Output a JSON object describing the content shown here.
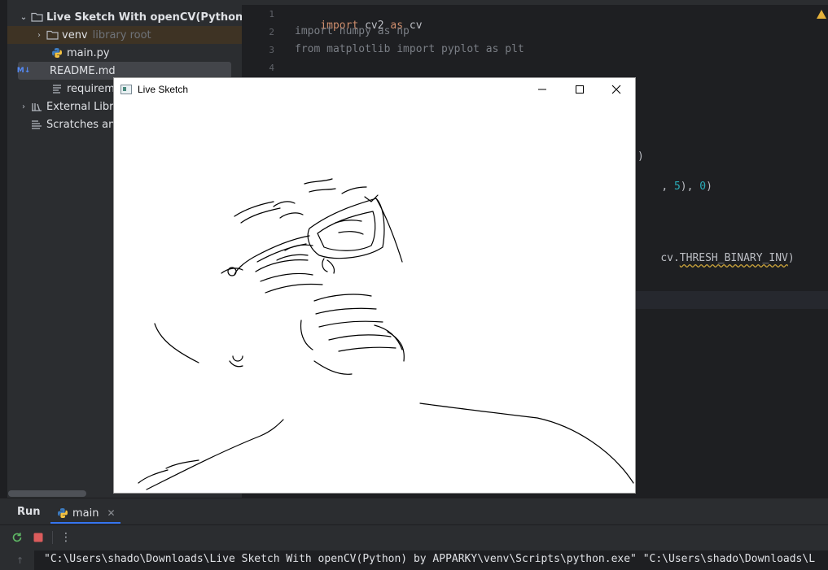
{
  "project": {
    "root": {
      "name": "Live Sketch With openCV(Python) by"
    },
    "venv": {
      "name": "venv",
      "hint": "library root"
    },
    "files": [
      "main.py",
      "README.md",
      "requireme"
    ],
    "external": "External Libr",
    "scratches": "Scratches an"
  },
  "editor": {
    "line_numbers": [
      "1",
      "2",
      "3",
      "4"
    ],
    "code": {
      "l1_kw1": "import",
      "l1_mod": " cv2 ",
      "l1_kw2": "as",
      "l1_alias": " cv",
      "l2": "import numpy as np",
      "l3": "from matplotlib import pyplot as plt",
      "frag1": ")",
      "frag2_pre": ", ",
      "frag2_n1": "5",
      "frag2_mid": "), ",
      "frag2_n2": "0",
      "frag2_post": ")",
      "frag3_pre": "cv.",
      "frag3_const": "THRESH_BINARY_INV",
      "frag3_post": ")"
    }
  },
  "run": {
    "title": "Run",
    "tab_label": "main",
    "console_line": "\"C:\\Users\\shado\\Downloads\\Live Sketch With openCV(Python) by APPARKY\\venv\\Scripts\\python.exe\" \"C:\\Users\\shado\\Downloads\\L"
  },
  "sketch_window": {
    "title": "Live Sketch"
  },
  "icons": {
    "folder": "folder-icon",
    "python": "python-file-icon",
    "markdown": "markdown-file-icon",
    "text": "text-file-icon",
    "library": "library-icon",
    "scratches": "scratches-icon",
    "rerun": "rerun-icon",
    "stop": "stop-icon",
    "more": "more-vertical-icon",
    "warning": "warning-icon"
  },
  "colors": {
    "accent": "#3574f0",
    "keyword": "#cf8e6d",
    "number": "#2aacb8",
    "stop": "#db5c5c",
    "rerun": "#5fb865"
  }
}
